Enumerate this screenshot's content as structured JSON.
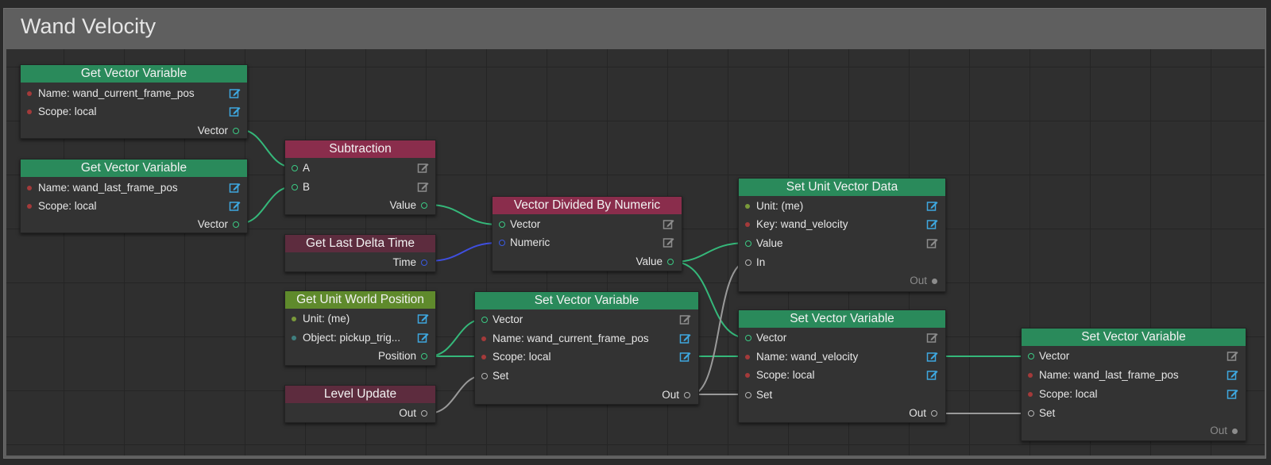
{
  "graph": {
    "title": "Wand Velocity",
    "colors": {
      "wire_vector": "#35b87a",
      "wire_numeric": "#3f4fe0",
      "wire_flow": "#9a9a9a",
      "header_green": "#2a8a5b",
      "header_red": "#8a2d4c",
      "header_dark_red": "#5d2c3e",
      "header_olive": "#5f8a2c"
    }
  },
  "nodes": {
    "get_vec_current": {
      "title": "Get Vector Variable",
      "name": "Name: wand_current_frame_pos",
      "scope": "Scope: local",
      "output": "Vector",
      "name_icon": "edit-icon",
      "scope_icon": "edit-icon"
    },
    "get_vec_last": {
      "title": "Get Vector Variable",
      "name": "Name: wand_last_frame_pos",
      "scope": "Scope: local",
      "output": "Vector",
      "name_icon": "edit-icon",
      "scope_icon": "edit-icon"
    },
    "subtraction": {
      "title": "Subtraction",
      "in_a": "A",
      "in_b": "B",
      "output": "Value"
    },
    "delta_time": {
      "title": "Get Last Delta Time",
      "output": "Time"
    },
    "vec_div": {
      "title": "Vector Divided By Numeric",
      "in_vector": "Vector",
      "in_numeric": "Numeric",
      "output": "Value"
    },
    "set_unit_vec": {
      "title": "Set Unit Vector Data",
      "unit": "Unit: (me)",
      "key": "Key: wand_velocity",
      "in_value": "Value",
      "in_flow": "In",
      "out_flow": "Out"
    },
    "unit_world_pos": {
      "title": "Get Unit World Position",
      "unit": "Unit: (me)",
      "object": "Object: pickup_trig...",
      "output": "Position"
    },
    "level_update": {
      "title": "Level Update",
      "output": "Out"
    },
    "set_vec_current": {
      "title": "Set Vector Variable",
      "in_vector": "Vector",
      "name": "Name: wand_current_frame_pos",
      "scope": "Scope: local",
      "in_set": "Set",
      "out_flow": "Out"
    },
    "set_vec_velocity": {
      "title": "Set Vector Variable",
      "in_vector": "Vector",
      "name": "Name: wand_velocity",
      "scope": "Scope: local",
      "in_set": "Set",
      "out_flow": "Out"
    },
    "set_vec_last": {
      "title": "Set Vector Variable",
      "in_vector": "Vector",
      "name": "Name: wand_last_frame_pos",
      "scope": "Scope: local",
      "in_set": "Set",
      "out_flow": "Out"
    }
  }
}
